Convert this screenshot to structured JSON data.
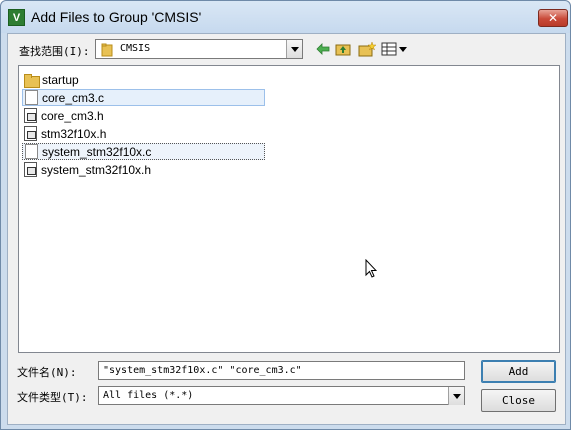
{
  "window": {
    "title": "Add Files to Group 'CMSIS'",
    "icon_letter": "V",
    "close_glyph": "✕"
  },
  "toolbar": {
    "look_in_label": "查找范围(I):",
    "look_in_value": "CMSIS",
    "icons": [
      "back-arrow-icon",
      "up-folder-icon",
      "new-folder-icon",
      "view-menu-icon"
    ]
  },
  "files": [
    {
      "name": "startup",
      "type": "folder",
      "state": "normal"
    },
    {
      "name": "core_cm3.c",
      "type": "c-file",
      "state": "selected"
    },
    {
      "name": "core_cm3.h",
      "type": "h-file",
      "state": "normal"
    },
    {
      "name": "stm32f10x.h",
      "type": "h-file",
      "state": "normal"
    },
    {
      "name": "system_stm32f10x.c",
      "type": "c-file",
      "state": "focused"
    },
    {
      "name": "system_stm32f10x.h",
      "type": "h-file",
      "state": "normal"
    }
  ],
  "form": {
    "filename_label": "文件名(N):",
    "filename_value": "\"system_stm32f10x.c\" \"core_cm3.c\"",
    "filetype_label": "文件类型(T):",
    "filetype_value": "All files (*.*)"
  },
  "buttons": {
    "add": "Add",
    "close": "Close"
  },
  "colors": {
    "selection": "#e6f0fb",
    "selection_border": "#9cc0ea",
    "close_button": "#c94a39"
  }
}
